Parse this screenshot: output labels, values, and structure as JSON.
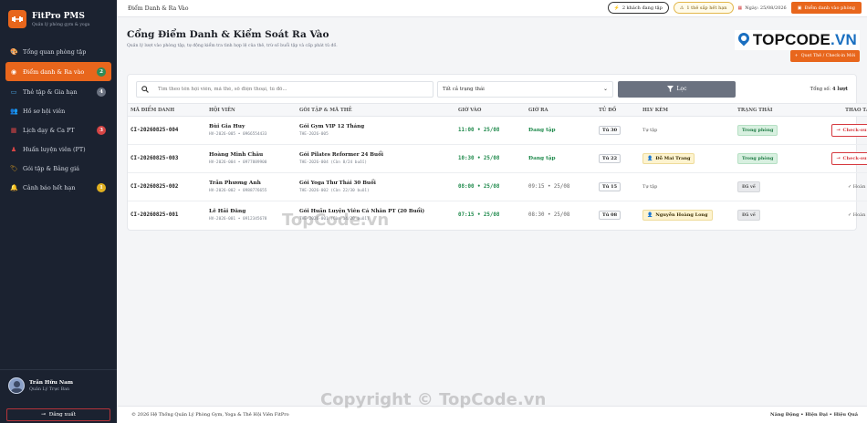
{
  "brand": {
    "title": "FitPro PMS",
    "subtitle": "Quản lý phòng gym & yoga"
  },
  "sidebar": {
    "items": [
      {
        "label": "Tổng quan phòng tập",
        "icon": "palette-icon",
        "badge": "",
        "active": false
      },
      {
        "label": "Điểm danh & Ra vào",
        "icon": "globe-icon",
        "badge": "2",
        "badge_color": "#2e8b57",
        "active": true
      },
      {
        "label": "Thẻ tập & Gia hạn",
        "icon": "card-icon",
        "badge": "4",
        "badge_color": "#6b7280",
        "active": false
      },
      {
        "label": "Hồ sơ hội viên",
        "icon": "members-icon",
        "badge": "",
        "active": false
      },
      {
        "label": "Lịch dạy & Ca PT",
        "icon": "calendar-icon",
        "badge": "3",
        "badge_color": "#d64545",
        "active": false
      },
      {
        "label": "Huấn luyện viên (PT)",
        "icon": "trainer-icon",
        "badge": "",
        "active": false
      },
      {
        "label": "Gói tập & Bảng giá",
        "icon": "tag-icon",
        "badge": "",
        "active": false
      },
      {
        "label": "Cảnh báo hết hạn",
        "icon": "bell-icon",
        "badge": "1",
        "badge_color": "#e0b020",
        "active": false
      }
    ]
  },
  "user": {
    "name": "Trần Hữu Nam",
    "role": "Quản Lý Trực Ban"
  },
  "logout_label": "Đăng xuất",
  "topbar": {
    "title": "Điểm Danh & Ra Vào",
    "pill_active": "2 khách đang tập",
    "pill_expiring": "1 thẻ sắp hết hạn",
    "date": "Ngày: 25/08/2026",
    "checkin_btn": "Điểm danh vào phòng"
  },
  "page": {
    "title": "Cổng Điểm Danh & Kiểm Soát Ra Vào",
    "subtitle": "Quản lý lượt vào phòng tập, tự động kiểm tra tình hợp lệ của thẻ, trừ số buổi tập và cấp phát tủ đồ.",
    "scan_btn": "Quẹt Thẻ / Check-in Mới"
  },
  "filters": {
    "search_placeholder": "Tìm theo tên hội viên, mã thẻ, số điện thoại, tủ đồ...",
    "status_select": "Tất cả trạng thái",
    "filter_btn": "Lọc",
    "total_label": "Tổng số:",
    "total_value": "4 lượt"
  },
  "table": {
    "columns": [
      "MÃ ĐIỂM DANH",
      "HỘI VIÊN",
      "GÓI TẬP & MÃ THẺ",
      "GIỜ VÀO",
      "GIỜ RA",
      "TỦ ĐỒ",
      "HLV KÈM",
      "TRẠNG THÁI",
      "THAO TÁC"
    ],
    "rows": [
      {
        "code": "CI-20260825-004",
        "member": "Bùi Gia Huy",
        "member_sub": "HV-2026-005 • 0966554433",
        "package": "Gói Gym VIP 12 Tháng",
        "card": "THE-2026-005",
        "in": "11:00 • 25/08",
        "out": "Đang tập",
        "out_active": true,
        "locker": "Tủ 30",
        "trainer": "Tự tập",
        "trainer_is_pt": false,
        "status": "Trong phòng",
        "status_in": true,
        "action": "Check-out"
      },
      {
        "code": "CI-20260825-003",
        "member": "Hoàng Minh Châu",
        "member_sub": "HV-2026-004 • 0977889900",
        "package": "Gói Pilates Reformer 24 Buổi",
        "card": "THE-2026-004 (Còn 8/24 buổi)",
        "in": "10:30 • 25/08",
        "out": "Đang tập",
        "out_active": true,
        "locker": "Tủ 22",
        "trainer": "Đỗ Mai Trang",
        "trainer_is_pt": true,
        "status": "Trong phòng",
        "status_in": true,
        "action": "Check-out"
      },
      {
        "code": "CI-20260825-002",
        "member": "Trần Phương Anh",
        "member_sub": "HV-2026-002 • 0988776655",
        "package": "Gói Yoga Thư Thái 30 Buổi",
        "card": "THE-2026-002 (Còn 22/30 buổi)",
        "in": "08:00 • 25/08",
        "out": "09:15 • 25/08",
        "out_active": false,
        "locker": "Tủ 15",
        "trainer": "Tự tập",
        "trainer_is_pt": false,
        "status": "Đã về",
        "status_in": false,
        "action": "Hoàn tất"
      },
      {
        "code": "CI-20260825-001",
        "member": "Lê Hải Đăng",
        "member_sub": "HV-2026-001 • 0912345678",
        "package": "Gói Huấn Luyện Viên Cá Nhân PT (20 Buổi)",
        "card": "THE-2026-001 (Còn 14/20 buổi)",
        "in": "07:15 • 25/08",
        "out": "08:30 • 25/08",
        "out_active": false,
        "locker": "Tủ 08",
        "trainer": "Nguyễn Hoàng Long",
        "trainer_is_pt": true,
        "status": "Đã về",
        "status_in": false,
        "action": "Hoàn tất"
      }
    ]
  },
  "footer": {
    "left": "© 2026 Hệ Thống Quản Lý Phòng Gym, Yoga & Thẻ Hội Viên FitPro",
    "right": "Năng Động • Hiện Đại • Hiệu Quả"
  },
  "watermarks": {
    "brand": "TOPCODE",
    "brand_suffix": ".VN",
    "center": "TopCode.vn",
    "bottom": "Copyright © TopCode.vn"
  }
}
